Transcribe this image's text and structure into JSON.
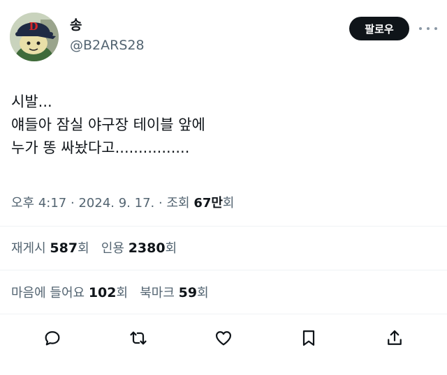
{
  "author": {
    "display_name": "송",
    "handle": "@B2ARS28",
    "avatar_letter": "D"
  },
  "follow_label": "팔로우",
  "tweet": {
    "lines": [
      "시발...",
      "얘들아 잠실 야구장 테이블 앞에",
      "누가 똥 싸놨다고................"
    ]
  },
  "meta": {
    "time": "오후 4:17",
    "separator": "·",
    "date": "2024. 9. 17.",
    "views_label": "조회",
    "views_count": "67만",
    "views_suffix": "회"
  },
  "stats": {
    "reposts_label": "재게시",
    "reposts_count": "587",
    "reposts_suffix": "회",
    "quotes_label": "인용",
    "quotes_count": "2380",
    "quotes_suffix": "회",
    "likes_label": "마음에 들어요",
    "likes_count": "102",
    "likes_suffix": "회",
    "bookmarks_label": "북마크",
    "bookmarks_count": "59",
    "bookmarks_suffix": "회"
  },
  "icons": {
    "reply": "reply-icon",
    "repost": "repost-icon",
    "like": "heart-icon",
    "bookmark": "bookmark-icon",
    "share": "share-icon",
    "more": "more-icon"
  },
  "colors": {
    "text": "#0f1419",
    "muted": "#536471",
    "divider": "#eff3f4",
    "button_bg": "#0f1419",
    "avatar_cap": "#1f2a44",
    "avatar_letter": "#d62828"
  }
}
